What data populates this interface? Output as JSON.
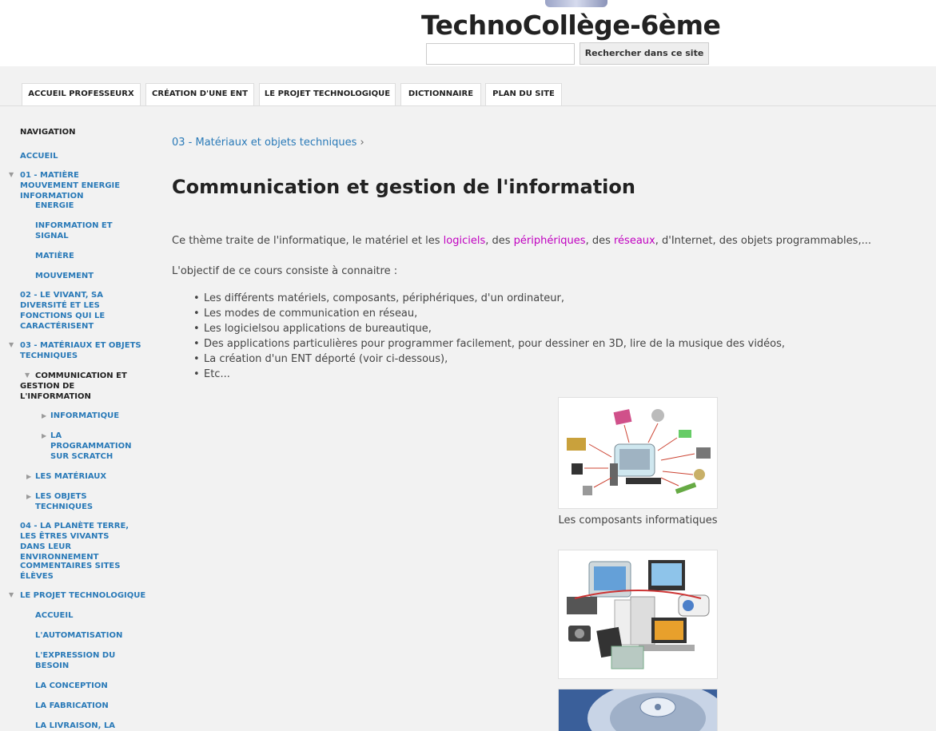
{
  "header": {
    "site_title": "TechnoCollège-6ème",
    "search_value": "",
    "search_button_label": "Rechercher dans ce site"
  },
  "topnav": {
    "tabs": [
      {
        "label": "ACCUEIL PROFESSEURX"
      },
      {
        "label": "CRÉATION D'UNE ENT"
      },
      {
        "label": "LE PROJET TECHNOLOGIQUE"
      },
      {
        "label": "DICTIONNAIRE"
      },
      {
        "label": "PLAN DU SITE"
      }
    ]
  },
  "sidebar": {
    "heading": "NAVIGATION",
    "items": [
      {
        "label": "ACCUEIL"
      },
      {
        "label": "01 - MATIÈRE MOUVEMENT ENERGIE INFORMATION"
      },
      {
        "label": "ENERGIE"
      },
      {
        "label": "INFORMATION ET SIGNAL"
      },
      {
        "label": "MATIÈRE"
      },
      {
        "label": "MOUVEMENT"
      },
      {
        "label": "02 - LE VIVANT, SA DIVERSITÉ ET LES FONCTIONS QUI LE CARACTÉRISENT"
      },
      {
        "label": "03 - MATÉRIAUX ET OBJETS TECHNIQUES"
      },
      {
        "label": "COMMUNICATION ET GESTION DE L'INFORMATION"
      },
      {
        "label": "INFORMATIQUE"
      },
      {
        "label": "LA PROGRAMMATION SUR SCRATCH"
      },
      {
        "label": "LES MATÉRIAUX"
      },
      {
        "label": "LES OBJETS TECHNIQUES"
      },
      {
        "label": "04 - LA PLANÈTE TERRE, LES ÊTRES VIVANTS DANS LEUR ENVIRONNEMENT"
      },
      {
        "label": "COMMENTAIRES SITES ÉLÈVES"
      },
      {
        "label": "LE PROJET TECHNOLOGIQUE"
      },
      {
        "label": "ACCUEIL"
      },
      {
        "label": "L'AUTOMATISATION"
      },
      {
        "label": "L'EXPRESSION DU BESOIN"
      },
      {
        "label": "LA CONCEPTION"
      },
      {
        "label": "LA FABRICATION"
      },
      {
        "label": "LA LIVRAISON, LA"
      }
    ]
  },
  "main": {
    "breadcrumb": {
      "link": "03 - Matériaux et objets techniques",
      "separator": "›"
    },
    "title": "Communication et gestion de l'information",
    "intro": {
      "part1": "Ce thème traite de l'informatique, le matériel et les ",
      "link1": "logiciels",
      "part2": ", des ",
      "link2": "périphériques",
      "part3": ", des ",
      "link3": "réseaux",
      "part4": ", d'Internet, des objets programmables,..."
    },
    "objective": "L'objectif de ce cours consiste à connaitre :",
    "bullets": [
      "Les différents matériels, composants, périphériques, d'un ordinateur,",
      "Les modes de communication en réseau,",
      "Les logicielsou applications de bureautique,",
      "Des applications particulières pour programmer facilement, pour dessiner en 3D, lire de la musique des vidéos,",
      "La création d'un ENT déporté (voir ci-dessous),",
      "Etc..."
    ],
    "figure1_caption": "Les composants informatiques"
  },
  "colors": {
    "link_blue": "#2a7ab8",
    "highlight_magenta": "#c000c0",
    "background": "#f2f2f2"
  }
}
